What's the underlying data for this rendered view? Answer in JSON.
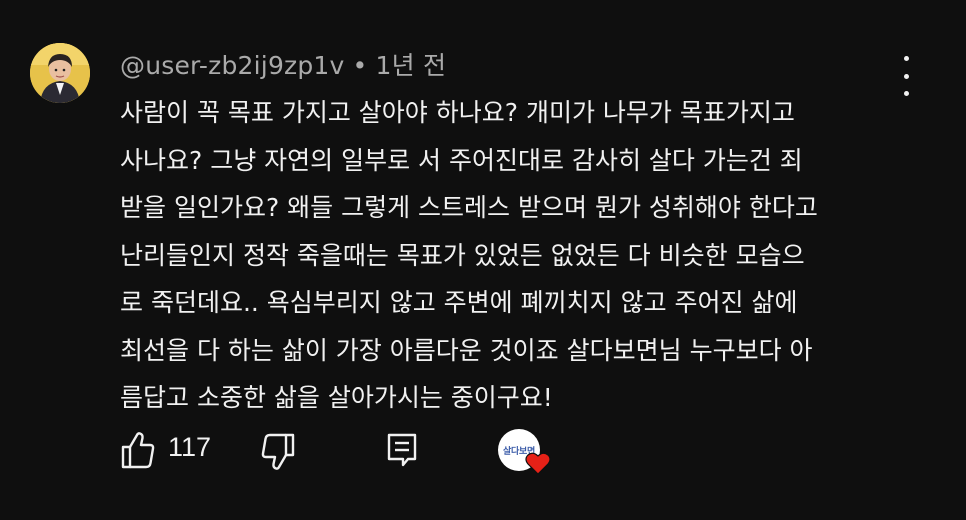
{
  "comment": {
    "author": "@user-zb2ij9zp1v",
    "separator": "•",
    "timestamp": "1년 전",
    "lines": [
      "사람이 꼭 목표 가지고 살아야 하나요? 개미가 나무가 목표가지고",
      "사나요? 그냥 자연의 일부로 서 주어진대로 감사히 살다 가는건 죄",
      "받을 일인가요? 왜들 그렇게 스트레스 받으며 뭔가 성취해야 한다고",
      "난리들인지 정작 죽을때는 목표가 있었든 없었든 다 비슷한 모습으",
      "로 죽던데요.. 욕심부리지 않고 주변에 폐끼치지 않고 주어진 삶에",
      "최선을 다 하는 삶이 가장 아름다운 것이죠 살다보면님 누구보다 아",
      "름답고 소중한 삶을 살아가시는 중이구요!"
    ]
  },
  "actions": {
    "like_count": "117",
    "creator_avatar_text": "살다보면"
  },
  "icons": {
    "like": "thumbs-up-icon",
    "dislike": "thumbs-down-icon",
    "reply": "reply-comment-icon",
    "menu": "more-vertical-icon",
    "heart": "heart-icon"
  },
  "colors": {
    "background": "#0f0f0f",
    "text": "#f1f1f1",
    "meta": "#aaaaaa",
    "heart": "#e62117"
  }
}
